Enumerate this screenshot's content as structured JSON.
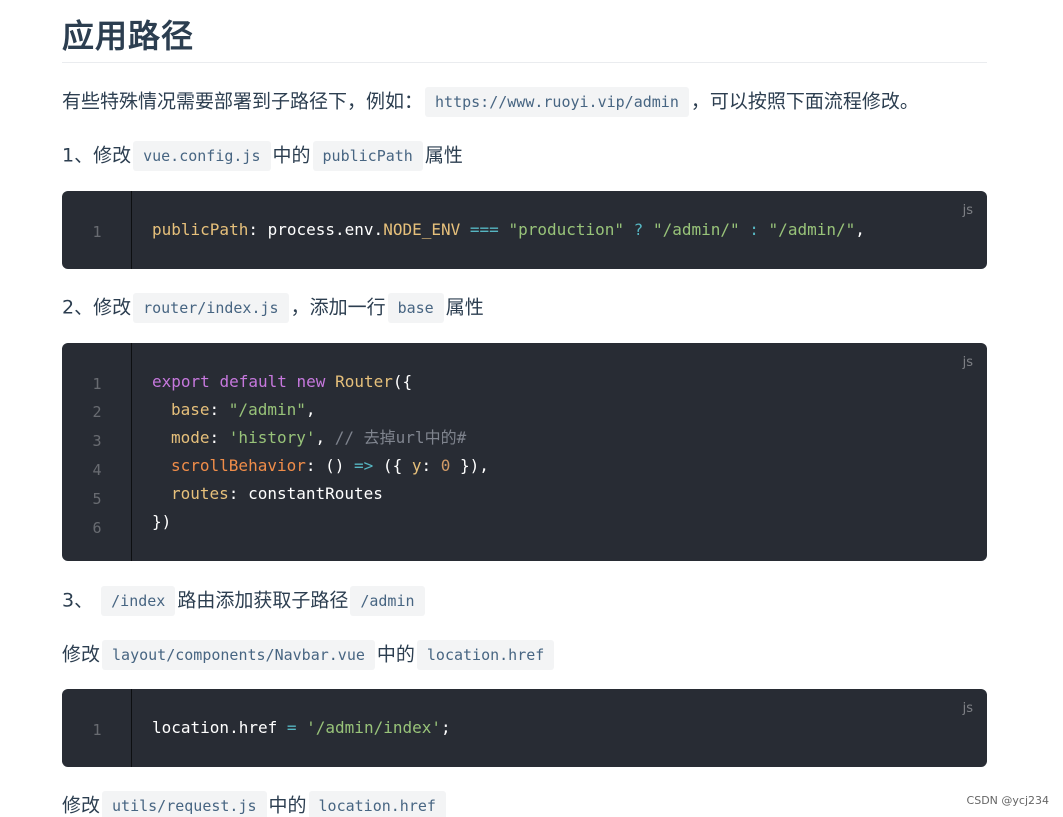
{
  "page": {
    "title": "应用路径",
    "watermark": "CSDN @ycj234"
  },
  "intro": {
    "text_before": "有些特殊情况需要部署到子路径下，例如：",
    "url_code": "https://www.ruoyi.vip/admin",
    "text_after": "，可以按照下面流程修改。"
  },
  "step1": {
    "prefix": "1、修改",
    "file_code": "vue.config.js",
    "middle": "中的",
    "prop_code": "publicPath",
    "suffix": "属性"
  },
  "code1": {
    "lang": "js",
    "line_numbers": [
      "1"
    ],
    "tokens": {
      "prop": "publicPath",
      "colon": ": ",
      "obj": "process.env.",
      "env": "NODE_ENV",
      "space1": " ",
      "op": "===",
      "space2": " ",
      "str1": "\"production\"",
      "q": " ? ",
      "str2": "\"/admin/\"",
      "c": " : ",
      "str3": "\"/admin/\"",
      "end": ","
    }
  },
  "step2": {
    "prefix": "2、修改",
    "file_code": "router/index.js",
    "middle": "，添加一行",
    "prop_code": "base",
    "suffix": "属性"
  },
  "code2": {
    "lang": "js",
    "line_numbers": [
      "1",
      "2",
      "3",
      "4",
      "5",
      "6"
    ],
    "l1": {
      "kw1": "export",
      "kw2": "default",
      "kw3": "new",
      "cls": "Router",
      "open": "({"
    },
    "l2": {
      "prop": "base",
      "colon": ": ",
      "str": "\"/admin\"",
      "end": ","
    },
    "l3": {
      "prop": "mode",
      "colon": ": ",
      "str": "'history'",
      "end": ", ",
      "comment": "// 去掉url中的#"
    },
    "l4": {
      "prop": "scrollBehavior",
      "colon": ": ",
      "paren": "() ",
      "arrow": "=>",
      "open": " ({ ",
      "y": "y",
      "ycolon": ": ",
      "zero": "0",
      "close": " }),"
    },
    "l5": {
      "prop": "routes",
      "colon": ": ",
      "val": "constantRoutes"
    },
    "l6": {
      "close": "})"
    }
  },
  "step3": {
    "prefix": "3、",
    "path_code": "/index",
    "middle": "路由添加获取子路径",
    "sub_code": "/admin"
  },
  "step3a": {
    "prefix": "修改",
    "file_code": "layout/components/Navbar.vue",
    "middle": "中的",
    "prop_code": "location.href"
  },
  "code3": {
    "lang": "js",
    "line_numbers": [
      "1"
    ],
    "tokens": {
      "obj": "location.href",
      "op1": " = ",
      "str": "'/admin/index'",
      "end": ";"
    }
  },
  "step3b": {
    "prefix": "修改",
    "file_code": "utils/request.js",
    "middle": "中的",
    "prop_code": "location.href"
  }
}
